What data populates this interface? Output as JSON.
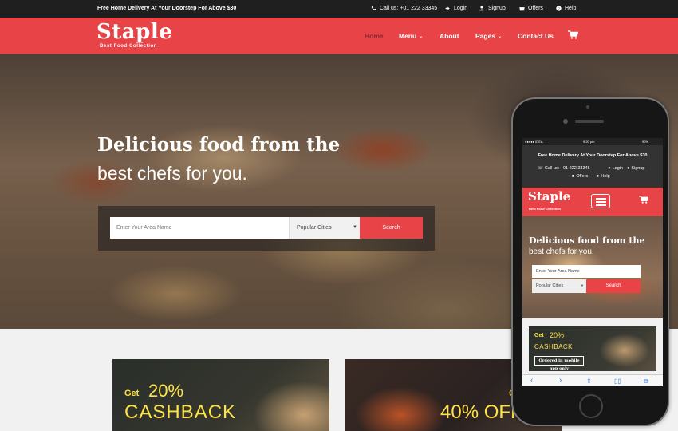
{
  "topbar": {
    "promo": "Free Home Delivery At Your Doorstep For Above $30",
    "call": "Call us: +01 222 33345",
    "login": "Login",
    "signup": "Signup",
    "offers": "Offers",
    "help": "Help"
  },
  "header": {
    "logo": "Staple",
    "tagline": "Best Food Collection",
    "nav": {
      "home": "Home",
      "menu": "Menu",
      "about": "About",
      "pages": "Pages",
      "contact": "Contact Us"
    },
    "dropdown_caret": "⌄",
    "cart_icon": "cart-icon"
  },
  "hero": {
    "headline": "Delicious food from the",
    "subheadline": "best chefs for you.",
    "search": {
      "placeholder": "Enter Your Area Name",
      "select_value": "Popular Cities",
      "button": "Search"
    }
  },
  "cards": [
    {
      "get": "Get",
      "percent": "20%",
      "text": "CASHBACK"
    },
    {
      "get": "G",
      "text": "40% OFF"
    }
  ],
  "mobile": {
    "status": {
      "carrier": "●●●●● IDEA",
      "time": "9:20 pm",
      "battery": "90%"
    },
    "promo": "Free Home Delivery At Your Doorstep For Above $30",
    "call": "Call us: +01 222 33345",
    "login": "Login",
    "signup": "Signup",
    "offers": "Offers",
    "help": "Help",
    "logo": "Staple",
    "tagline": "Best Food Collection",
    "headline": "Delicious food from the",
    "subheadline": "best chefs for you.",
    "placeholder": "Enter Your Area Name",
    "select_value": "Popular Cities",
    "button": "Search",
    "card_get": "Get",
    "card_percent": "20%",
    "card_text": "CASHBACK",
    "card_badge": "Ordered in mobile app only"
  },
  "colors": {
    "brand": "#e84347",
    "topbar": "#1f1f1f",
    "accent_yellow": "#ffe24a"
  }
}
